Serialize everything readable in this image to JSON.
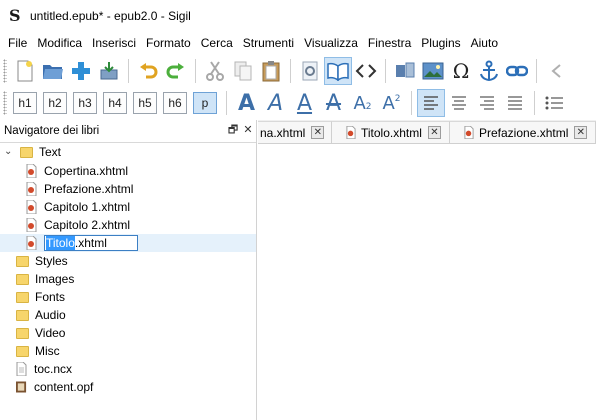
{
  "window": {
    "title": "untitled.epub* - epub2.0 - Sigil"
  },
  "menu": [
    "File",
    "Modifica",
    "Inserisci",
    "Formato",
    "Cerca",
    "Strumenti",
    "Visualizza",
    "Finestra",
    "Plugins",
    "Aiuto"
  ],
  "toolbar_main": {
    "icons": [
      "new-file-icon",
      "open-folder-icon",
      "add-file-icon",
      "save-icon",
      "undo-icon",
      "redo-icon",
      "cut-icon",
      "copy-icon",
      "paste-icon",
      "preview-icon",
      "book-view-icon",
      "code-view-icon",
      "metadata-editor-icon",
      "insert-image-icon",
      "insert-special-char-icon",
      "insert-id-icon",
      "insert-link-icon",
      "back-icon"
    ],
    "active": "book-view-icon"
  },
  "toolbar_format": {
    "headings": [
      "h1",
      "h2",
      "h3",
      "h4",
      "h5",
      "h6",
      "p"
    ],
    "active_heading": "p",
    "text_style_glyph": "A",
    "subscript_mark": "2",
    "superscript_mark": "2",
    "align_active": "align-left"
  },
  "book_browser": {
    "title": "Navigatore dei libri",
    "undock_glyph": "🗗",
    "close_glyph": "✕",
    "items": [
      {
        "label": "Text",
        "type": "folder",
        "expanded": true
      },
      {
        "label": "Copertina.xhtml",
        "type": "xhtml"
      },
      {
        "label": "Prefazione.xhtml",
        "type": "xhtml"
      },
      {
        "label": "Capitolo 1.xhtml",
        "type": "xhtml"
      },
      {
        "label": "Capitolo 2.xhtml",
        "type": "xhtml"
      },
      {
        "label": "Styles",
        "type": "folder"
      },
      {
        "label": "Images",
        "type": "folder"
      },
      {
        "label": "Fonts",
        "type": "folder"
      },
      {
        "label": "Audio",
        "type": "folder"
      },
      {
        "label": "Video",
        "type": "folder"
      },
      {
        "label": "Misc",
        "type": "folder"
      },
      {
        "label": "toc.ncx",
        "type": "ncx"
      },
      {
        "label": "content.opf",
        "type": "opf"
      }
    ],
    "rename": {
      "selected_text": "Titolo",
      "rest_text": ".xhtml"
    }
  },
  "tabs": [
    {
      "label": "na.xhtml"
    },
    {
      "label": "Titolo.xhtml"
    },
    {
      "label": "Prefazione.xhtml"
    }
  ],
  "tab_close_glyph": "✕",
  "colors": {
    "accent": "#3d6fa8",
    "selection": "#e5f1fb",
    "folder": "#f7d56b",
    "rename_highlight": "#3399ff"
  }
}
